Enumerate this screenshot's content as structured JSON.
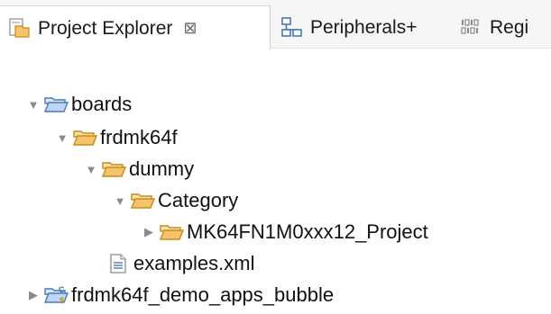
{
  "tabs": {
    "project_explorer": {
      "label": "Project Explorer",
      "close_glyph": "⊠",
      "icon": "project-explorer-icon"
    },
    "peripherals": {
      "label": "Peripherals+",
      "icon": "peripherals-icon"
    },
    "registers": {
      "label": "Regi",
      "icon": "registers-icon"
    }
  },
  "tree": {
    "rows": [
      {
        "label": "boards",
        "expanded": true,
        "icon": "open-folder-blue-icon"
      },
      {
        "label": "frdmk64f",
        "expanded": true,
        "icon": "open-folder-icon"
      },
      {
        "label": "dummy",
        "expanded": true,
        "icon": "open-folder-icon"
      },
      {
        "label": "Category",
        "expanded": true,
        "icon": "open-folder-icon"
      },
      {
        "label": "MK64FN1M0xxx12_Project",
        "expanded": false,
        "icon": "folder-icon"
      },
      {
        "label": "examples.xml",
        "icon": "xml-file-icon"
      },
      {
        "label": "frdmk64f_demo_apps_bubble",
        "expanded": false,
        "icon": "c-project-icon"
      }
    ],
    "twisty_expanded": "▼",
    "twisty_collapsed": "▶"
  },
  "colors": {
    "folder_fill": "#f5c36b",
    "folder_stroke": "#c98a1a",
    "folder_blue_fill": "#bcd6f3",
    "folder_blue_stroke": "#4b79b8",
    "accent_blue": "#3f6fb0"
  }
}
